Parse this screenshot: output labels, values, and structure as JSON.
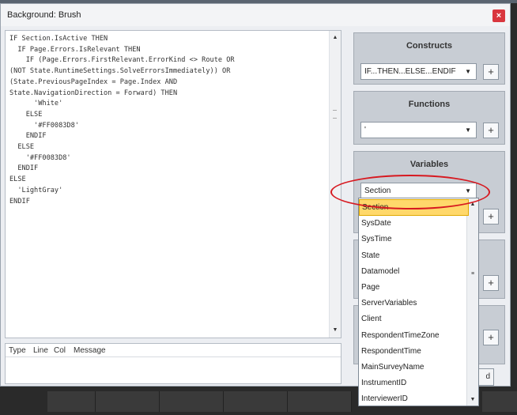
{
  "window": {
    "title": "Background: Brush",
    "close_label": "×"
  },
  "editor": {
    "code_lines": [
      "IF Section.IsActive THEN",
      "  IF Page.Errors.IsRelevant THEN",
      "    IF (Page.Errors.FirstRelevant.ErrorKind <> Route OR",
      "(NOT State.RuntimeSettings.SolveErrorsImmediately)) OR",
      "(State.PreviousPageIndex = Page.Index AND",
      "State.NavigationDirection = Forward) THEN",
      "      'White'",
      "    ELSE",
      "      '#FF0083D8'",
      "    ENDIF",
      "  ELSE",
      "    '#FF0083D8'",
      "  ENDIF",
      "ELSE",
      "  'LightGray'",
      "ENDIF"
    ]
  },
  "errors": {
    "columns": [
      "Type",
      "Line",
      "Col",
      "Message"
    ]
  },
  "constructs": {
    "header": "Constructs",
    "selected": "IF...THEN...ELSE...ENDIF",
    "add_label": "+"
  },
  "functions": {
    "header": "Functions",
    "selected": "'",
    "add_label": "+"
  },
  "variables": {
    "header": "Variables",
    "selected": "Section",
    "add_label": "+",
    "options": [
      "Section",
      "SysDate",
      "SysTime",
      "State",
      "Datamodel",
      "Page",
      "ServerVariables",
      "Client",
      "RespondentTimeZone",
      "RespondentTime",
      "MainSurveyName",
      "InstrumentID",
      "InterviewerID"
    ]
  },
  "extra_panel_1": {
    "add_label": "+"
  },
  "extra_panel_2": {
    "add_label": "+"
  },
  "ok_partial": "d",
  "colors": {
    "highlight": "#d71920",
    "selected_item": "#ffd86b",
    "close": "#d9363e"
  }
}
